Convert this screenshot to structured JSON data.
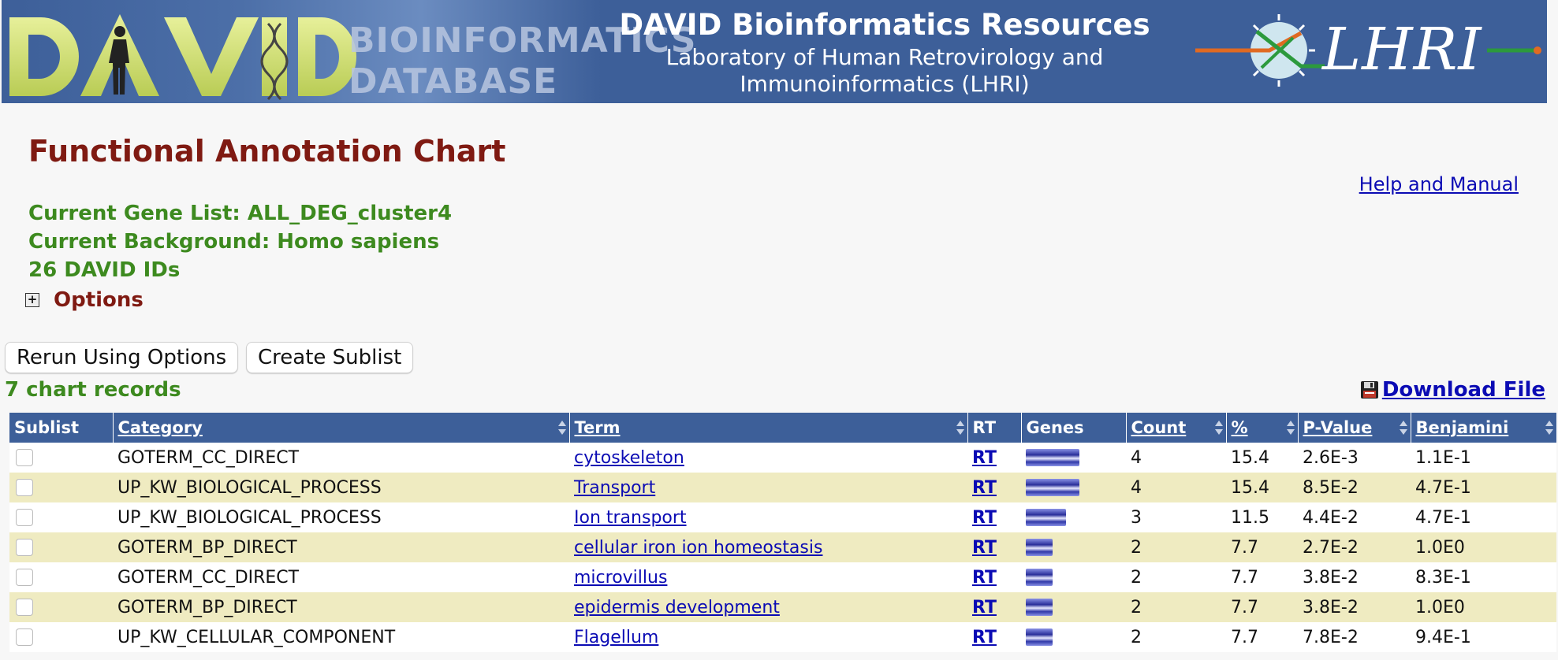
{
  "banner": {
    "logo_letters": "DAVID",
    "logo_subtitle_line1": "BIOINFORMATICS",
    "logo_subtitle_line2": "DATABASE",
    "title": "DAVID Bioinformatics Resources",
    "lab_line1": "Laboratory of Human Retrovirology and",
    "lab_line2": "Immunoinformatics (LHRI)",
    "lhri_logo_text": "LHRI"
  },
  "page": {
    "title": "Functional Annotation Chart",
    "help_link": "Help and Manual",
    "gene_list": "Current Gene List: ALL_DEG_cluster4",
    "background": "Current Background: Homo sapiens",
    "david_ids": "26 DAVID IDs",
    "options_label": "Options",
    "options_toggle": "+"
  },
  "buttons": {
    "rerun": "Rerun Using Options",
    "create_sublist": "Create Sublist"
  },
  "records_label": "7 chart records",
  "download_label": "Download File",
  "table": {
    "headers": {
      "sublist": "Sublist",
      "category": "Category",
      "term": "Term",
      "rt": "RT",
      "genes": "Genes",
      "count": "Count",
      "percent": "%",
      "pvalue": "P-Value",
      "benjamini": "Benjamini"
    },
    "rows": [
      {
        "category": "GOTERM_CC_DIRECT",
        "term": "cytoskeleton",
        "rt": "RT",
        "count": "4",
        "percent": "15.4",
        "pvalue": "2.6E-3",
        "benjamini": "1.1E-1",
        "gene_bar_fraction": 1.0
      },
      {
        "category": "UP_KW_BIOLOGICAL_PROCESS",
        "term": "Transport",
        "rt": "RT",
        "count": "4",
        "percent": "15.4",
        "pvalue": "8.5E-2",
        "benjamini": "4.7E-1",
        "gene_bar_fraction": 1.0
      },
      {
        "category": "UP_KW_BIOLOGICAL_PROCESS",
        "term": "Ion transport",
        "rt": "RT",
        "count": "3",
        "percent": "11.5",
        "pvalue": "4.4E-2",
        "benjamini": "4.7E-1",
        "gene_bar_fraction": 0.75
      },
      {
        "category": "GOTERM_BP_DIRECT",
        "term": "cellular iron ion homeostasis",
        "rt": "RT",
        "count": "2",
        "percent": "7.7",
        "pvalue": "2.7E-2",
        "benjamini": "1.0E0",
        "gene_bar_fraction": 0.5
      },
      {
        "category": "GOTERM_CC_DIRECT",
        "term": "microvillus",
        "rt": "RT",
        "count": "2",
        "percent": "7.7",
        "pvalue": "3.8E-2",
        "benjamini": "8.3E-1",
        "gene_bar_fraction": 0.5
      },
      {
        "category": "GOTERM_BP_DIRECT",
        "term": "epidermis development",
        "rt": "RT",
        "count": "2",
        "percent": "7.7",
        "pvalue": "3.8E-2",
        "benjamini": "1.0E0",
        "gene_bar_fraction": 0.5
      },
      {
        "category": "UP_KW_CELLULAR_COMPONENT",
        "term": "Flagellum",
        "rt": "RT",
        "count": "2",
        "percent": "7.7",
        "pvalue": "7.8E-2",
        "benjamini": "9.4E-1",
        "gene_bar_fraction": 0.5
      }
    ]
  },
  "colors": {
    "banner_blue": "#3d5f99",
    "title_maroon": "#7f1a12",
    "info_green": "#3d8a1f",
    "link_blue": "#0b0bb4",
    "row_alt": "#efebc1"
  },
  "icons": {
    "options_toggle": "plus-box-icon",
    "download": "floppy-disk-icon",
    "sort": "sort-arrows-icon"
  }
}
